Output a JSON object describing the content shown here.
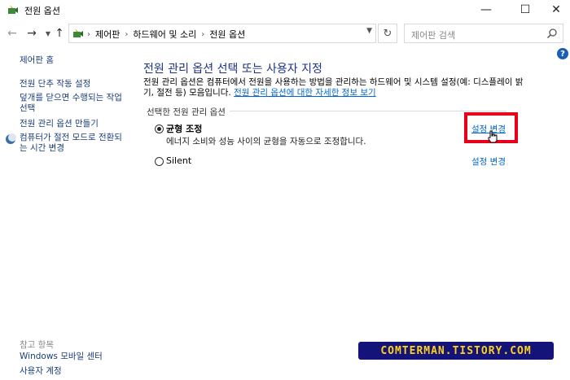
{
  "window": {
    "title": "전원 옵션",
    "minimize_glyph": "—",
    "maximize_glyph": "☐",
    "close_glyph": "✕"
  },
  "addressbar": {
    "breadcrumbs": [
      "제어판",
      "하드웨어 및 소리",
      "전원 옵션"
    ],
    "search_placeholder": "제어판 검색"
  },
  "sidebar": {
    "links": [
      "제어판 홈",
      "전원 단추 작동 설정",
      "덮개를 닫으면 수행되는 작업\n선택",
      "전원 관리 옵션 만들기",
      "컴퓨터가 절전 모드로 전환되\n는 시간 변경"
    ],
    "see_also_heading": "참고 항목",
    "see_also_links": [
      "Windows 모바일 센터",
      "사용자 계정"
    ]
  },
  "main": {
    "title": "전원 관리 옵션 선택 또는 사용자 지정",
    "description": "전원 관리 옵션은 컴퓨터에서 전원을 사용하는 방법을 관리하는 하드웨어 및 시스템 설정(예: 디스플레이 밝기, 절전 등) 모음입니다.",
    "description_link": "전원 관리 옵션에 대한 자세한 정보 보기",
    "group_label": "선택한 전원 관리 옵션",
    "plans": [
      {
        "name": "균형 조정",
        "description": "에너지 소비와 성능 사이의 균형을 자동으로 조정합니다.",
        "change_link": "설정 변경",
        "selected": true
      },
      {
        "name": "Silent",
        "description": "",
        "change_link": "설정 변경",
        "selected": false
      }
    ]
  },
  "watermark": "COMTERMAN.TISTORY.COM",
  "colors": {
    "link": "#0066cc",
    "title": "#1e3287",
    "highlight": "#e8001a",
    "watermark_bg": "#13137a",
    "watermark_text": "#ffd21a"
  }
}
